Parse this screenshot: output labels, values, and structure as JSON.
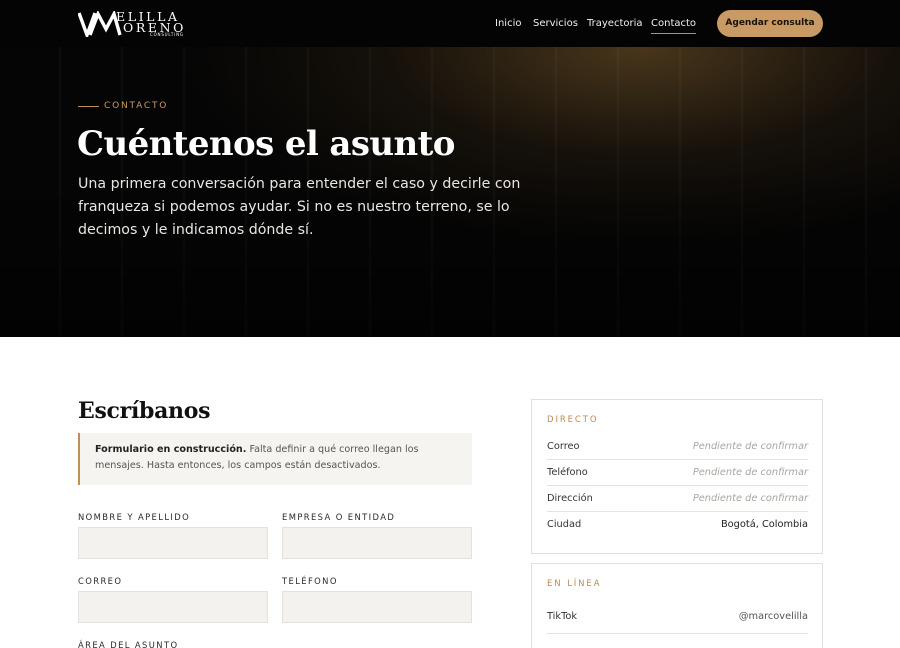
{
  "brand": {
    "logo_top": "ELILLA",
    "logo_mid": "ORENO",
    "logo_sub": "CONSULTING"
  },
  "nav": {
    "items": [
      {
        "label": "Inicio",
        "active": false
      },
      {
        "label": "Servicios",
        "active": false
      },
      {
        "label": "Trayectoria",
        "active": false
      },
      {
        "label": "Contacto",
        "active": true
      }
    ],
    "cta_label": "Agendar consulta"
  },
  "hero": {
    "eyebrow": "CONTACTO",
    "title": "Cuéntenos el asunto",
    "text": "Una primera conversación para entender el caso y decirle con franqueza si podemos ayudar. Si no es nuestro terreno, se lo decimos y le indicamos dónde sí."
  },
  "form": {
    "title": "Escríbanos",
    "notice_bold": "Formulario en construcción.",
    "notice_text": " Falta definir a qué correo llegan los mensajes. Hasta entonces, los campos están desactivados.",
    "fields": [
      {
        "label": "NOMBRE Y APELLIDO",
        "value": ""
      },
      {
        "label": "EMPRESA O ENTIDAD",
        "value": ""
      },
      {
        "label": "CORREO",
        "value": ""
      },
      {
        "label": "TELÉFONO",
        "value": ""
      },
      {
        "label": "ÁREA DEL ASUNTO",
        "value": ""
      }
    ]
  },
  "direct": {
    "title": "DIRECTO",
    "rows": [
      {
        "key": "Correo",
        "value": "Pendiente de confirmar"
      },
      {
        "key": "Teléfono",
        "value": "Pendiente de confirmar"
      },
      {
        "key": "Dirección",
        "value": "Pendiente de confirmar"
      },
      {
        "key": "Ciudad",
        "value": "Bogotá, Colombia"
      }
    ]
  },
  "online": {
    "title": "EN LÍNEA",
    "rows": [
      {
        "key": "TikTok",
        "value": "@marcovelilla"
      }
    ]
  },
  "colors": {
    "accent": "#c99a64",
    "header_bg": "#040404",
    "pending_text": "#aaa6a0"
  }
}
